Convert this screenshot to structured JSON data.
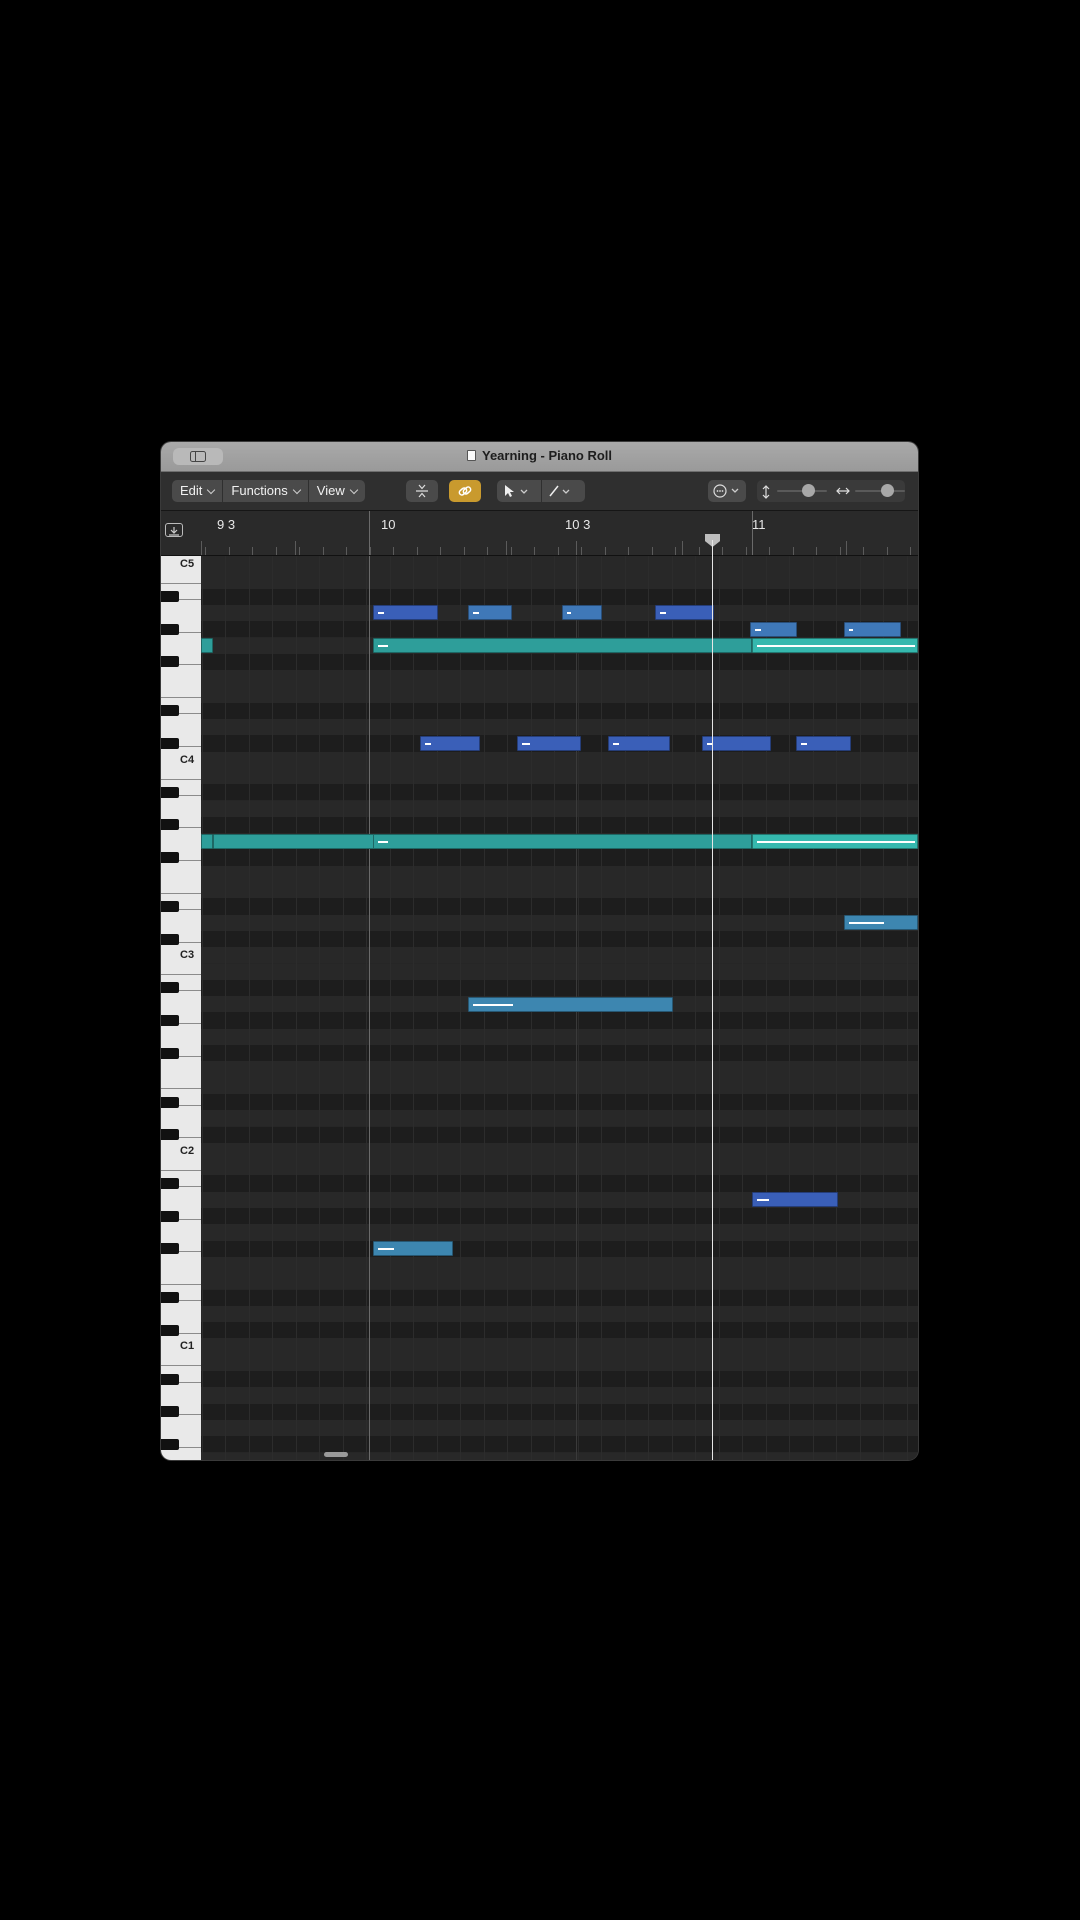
{
  "window": {
    "title": "Yearning - Piano Roll"
  },
  "toolbar": {
    "menus": [
      "Edit",
      "Functions",
      "View"
    ],
    "icons": {
      "collapse": "collapse-icon",
      "link": "link-icon",
      "pointer_tool": "pointer-tool-icon",
      "pencil_tool": "pencil-tool-icon",
      "more": "ellipsis-circle-icon",
      "vertical_zoom": "vertical-zoom-icon",
      "horizontal_zoom": "horizontal-zoom-icon"
    },
    "accent_color": "#c99a2e",
    "vertical_zoom_level": 0.6,
    "horizontal_zoom_level": 0.7
  },
  "ruler": {
    "bar_labels": [
      "9 3",
      "10",
      "10 3",
      "11"
    ]
  },
  "keyboard": {
    "octave_labels": [
      "C5",
      "C4",
      "C3",
      "C2",
      "C1"
    ]
  },
  "colors": {
    "note_blue": "#3a5fb8",
    "note_blue_alt": "#3f78b8",
    "note_teal": "#2e9e9a",
    "note_teal_selected": "#35b8ae",
    "note_bass": "#3d86b0"
  }
}
